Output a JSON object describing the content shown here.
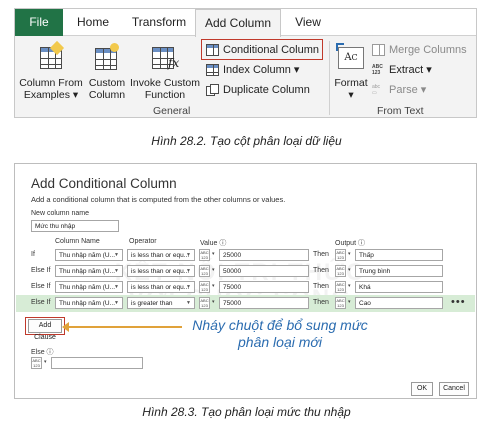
{
  "ribbon": {
    "tabs": [
      "File",
      "Home",
      "Transform",
      "Add Column",
      "View"
    ],
    "active_tab": "Add Column",
    "general": {
      "column_from_examples": [
        "Column From",
        "Examples"
      ],
      "custom_column": [
        "Custom",
        "Column"
      ],
      "invoke_custom_function": [
        "Invoke Custom",
        "Function"
      ],
      "conditional_column": "Conditional Column",
      "index_column": "Index Column",
      "duplicate_column": "Duplicate Column",
      "group_label": "General"
    },
    "from_text": {
      "format": "Format",
      "merge_columns": "Merge Columns",
      "extract": "Extract",
      "parse": "Parse",
      "group_label": "From Text"
    }
  },
  "caption_top": "Hình 28.2. Tạo cột phân loại dữ liệu",
  "dialog": {
    "title": "Add Conditional Column",
    "description": "Add a conditional column that is computed from the other columns or values.",
    "new_column_label": "New column name",
    "new_column_value": "Mức thu nhập",
    "headers": {
      "column_name": "Column Name",
      "operator": "Operator",
      "value": "Value ⓘ",
      "output": "Output ⓘ"
    },
    "abc_text": "ABC 123",
    "rules": [
      {
        "clause": "If",
        "column": "Thu nhập năm (U...",
        "operator": "is less than or equ...",
        "value": "25000",
        "then": "Then",
        "output": "Thấp"
      },
      {
        "clause": "Else If",
        "column": "Thu nhập năm (U...",
        "operator": "is less than or equ...",
        "value": "50000",
        "then": "Then",
        "output": "Trung bình"
      },
      {
        "clause": "Else If",
        "column": "Thu nhập năm (U...",
        "operator": "is less than or equ...",
        "value": "75000",
        "then": "Then",
        "output": "Khá"
      },
      {
        "clause": "Else If",
        "column": "Thu nhập năm (U...",
        "operator": "is greater than",
        "value": "75000",
        "then": "Then",
        "output": "Cao"
      }
    ],
    "more": "•••",
    "add_clause": "Add Clause",
    "callout": [
      "Nháy chuột để bổ sung mức",
      "phân loại mới"
    ],
    "else_label": "Else ⓘ",
    "else_value": "",
    "ok": "OK",
    "cancel": "Cancel"
  },
  "watermark": [
    "KẾT NỐI TRI THỨC",
    "VỚI CUỘC SỐNG"
  ],
  "caption_bottom": "Hình 28.3. Tạo phân loại mức thu nhập",
  "colors": {
    "file_tab": "#217346",
    "highlight_box": "#c0392b",
    "callout_text": "#2b6cb0",
    "arrow": "#e0a23a",
    "selected_row": "#d7ecd6"
  }
}
